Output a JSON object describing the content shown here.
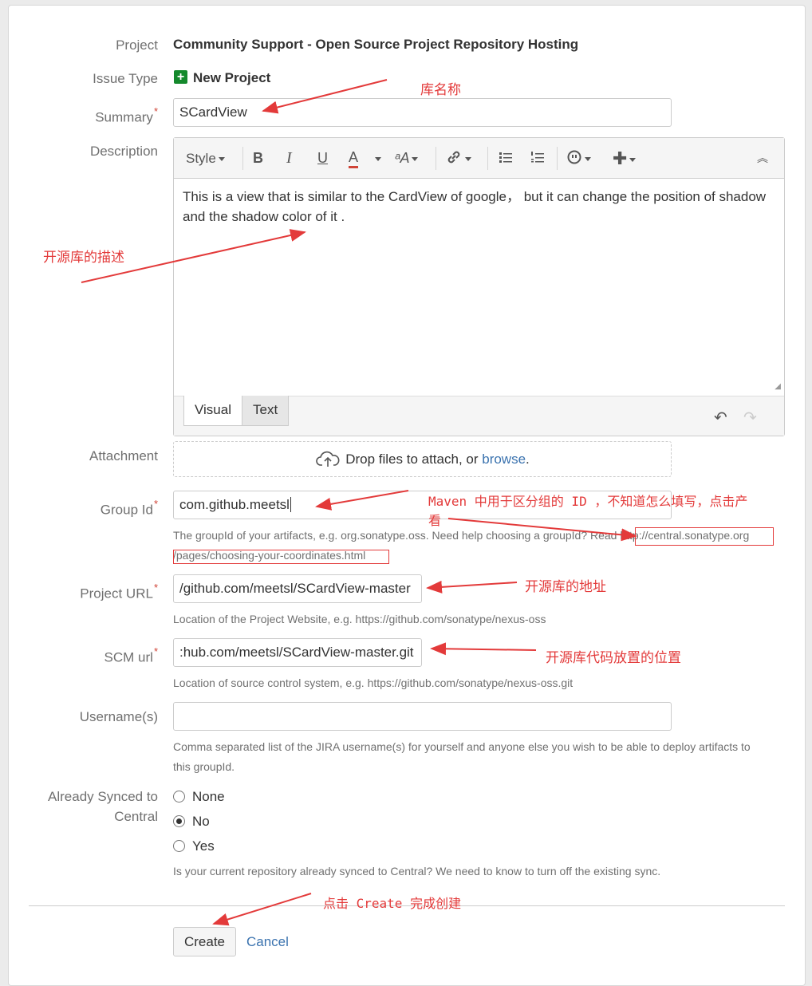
{
  "form": {
    "project": {
      "label": "Project",
      "value": "Community Support - Open Source Project Repository Hosting"
    },
    "issue_type": {
      "label": "Issue Type",
      "value": "New Project",
      "icon": "plus-square-icon"
    },
    "summary": {
      "label": "Summary",
      "required_mark": "*",
      "value": "SCardView"
    },
    "description": {
      "label": "Description",
      "toolbar": {
        "style": "Style",
        "bold": "B",
        "italic": "I",
        "underline": "U",
        "text_color": "A",
        "font_size": "ᵃA"
      },
      "content": "This is a view that is similar to the CardView of google， but it can change the position of shadow and the shadow color of it .",
      "tabs": [
        "Visual",
        "Text"
      ]
    },
    "attachment": {
      "label": "Attachment",
      "text": "Drop files to attach, or ",
      "link": "browse",
      "suffix": "."
    },
    "group_id": {
      "label": "Group Id",
      "required_mark": "*",
      "value": "com.github.meetsl",
      "help": "The groupId of your artifacts, e.g. org.sonatype.oss. Need help choosing a groupId? Read ",
      "help_link_1": "http://central.sonatype.org",
      "help_link_2": "/pages/choosing-your-coordinates.html"
    },
    "project_url": {
      "label": "Project URL",
      "required_mark": "*",
      "value": "/github.com/meetsl/SCardView-master",
      "help": "Location of the Project Website, e.g. https://github.com/sonatype/nexus-oss"
    },
    "scm_url": {
      "label": "SCM url",
      "required_mark": "*",
      "value": ":hub.com/meetsl/SCardView-master.git",
      "help": "Location of source control system, e.g. https://github.com/sonatype/nexus-oss.git"
    },
    "usernames": {
      "label": "Username(s)",
      "value": "",
      "help_line1": "Comma separated list of the JIRA username(s) for yourself and anyone else you wish to be able to deploy artifacts to",
      "help_line2": "this groupId."
    },
    "synced": {
      "label_line1": "Already Synced to",
      "label_line2": "Central",
      "options": [
        "None",
        "No",
        "Yes"
      ],
      "selected": "No",
      "help": "Is your current repository already synced to Central? We need to know to turn off the existing sync."
    },
    "buttons": {
      "create": "Create",
      "cancel": "Cancel"
    }
  },
  "annotations": {
    "summary": "库名称",
    "description": "开源库的描述",
    "group_id_line1": "Maven 中用于区分组的 ID ，不知道怎么填写，点击产",
    "group_id_line2": "看",
    "project_url": "开源库的地址",
    "scm_url": "开源库代码放置的位置",
    "create": "点击 Create 完成创建",
    "color": "#e33a3a"
  }
}
